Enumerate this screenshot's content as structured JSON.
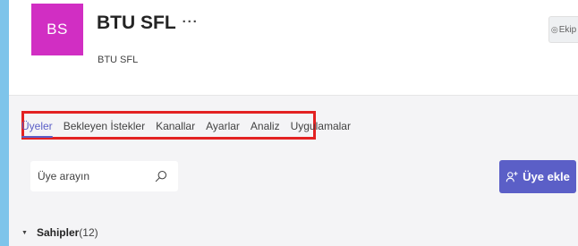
{
  "team": {
    "avatar_initials": "BS",
    "avatar_color": "#d12ec3",
    "name": "BTU SFL",
    "more_symbol": "···",
    "description": "BTU SFL",
    "type_button_label": "Ekip",
    "type_button_icon": "eye-icon"
  },
  "tabs": [
    {
      "label": "Üyeler",
      "active": true
    },
    {
      "label": "Bekleyen İstekler",
      "active": false
    },
    {
      "label": "Kanallar",
      "active": false
    },
    {
      "label": "Ayarlar",
      "active": false
    },
    {
      "label": "Analiz",
      "active": false
    },
    {
      "label": "Uygulamalar",
      "active": false
    }
  ],
  "search": {
    "placeholder": "Üye arayın",
    "icon": "search-icon"
  },
  "add_member": {
    "label": "Üye ekle",
    "icon": "add-person-icon",
    "color": "#5b5fc7"
  },
  "owners": {
    "label": "Sahipler",
    "count": "(12)"
  },
  "highlight_color": "#e32222",
  "accent_color": "#5b5fc7"
}
